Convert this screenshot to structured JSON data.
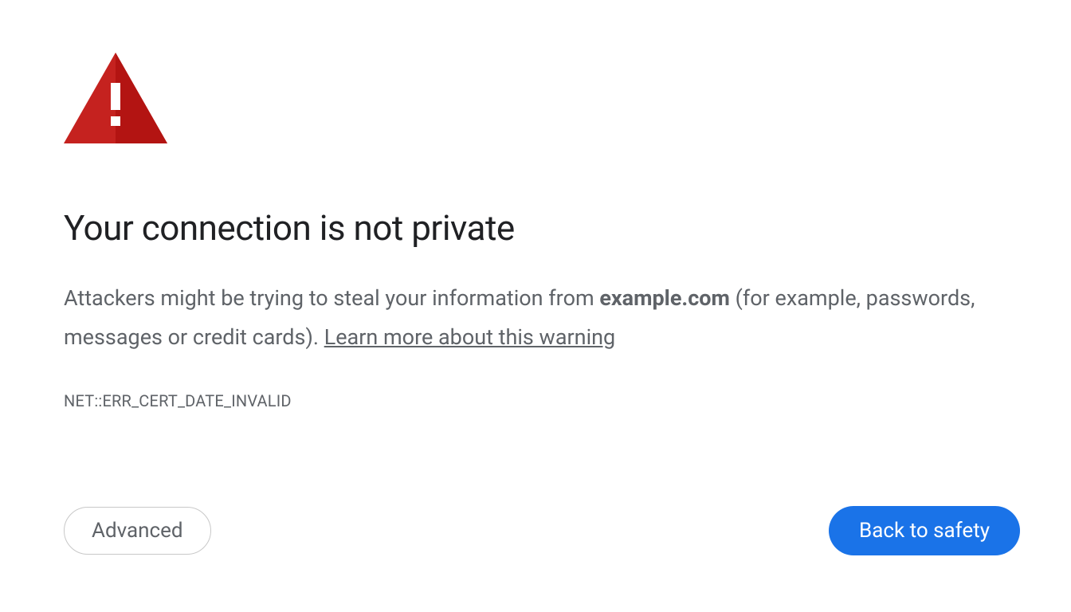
{
  "colors": {
    "danger": "#c5221f",
    "primary": "#1a73e8",
    "text": "#202124",
    "muted": "#5f6368"
  },
  "heading": "Your connection is not private",
  "body": {
    "prefix": "Attackers might be trying to steal your information from ",
    "host": "example.com",
    "suffix": " (for example, passwords, messages or credit cards). ",
    "learn_more": "Learn more about this warning"
  },
  "error_code": "NET::ERR_CERT_DATE_INVALID",
  "buttons": {
    "advanced": "Advanced",
    "back_to_safety": "Back to safety"
  }
}
